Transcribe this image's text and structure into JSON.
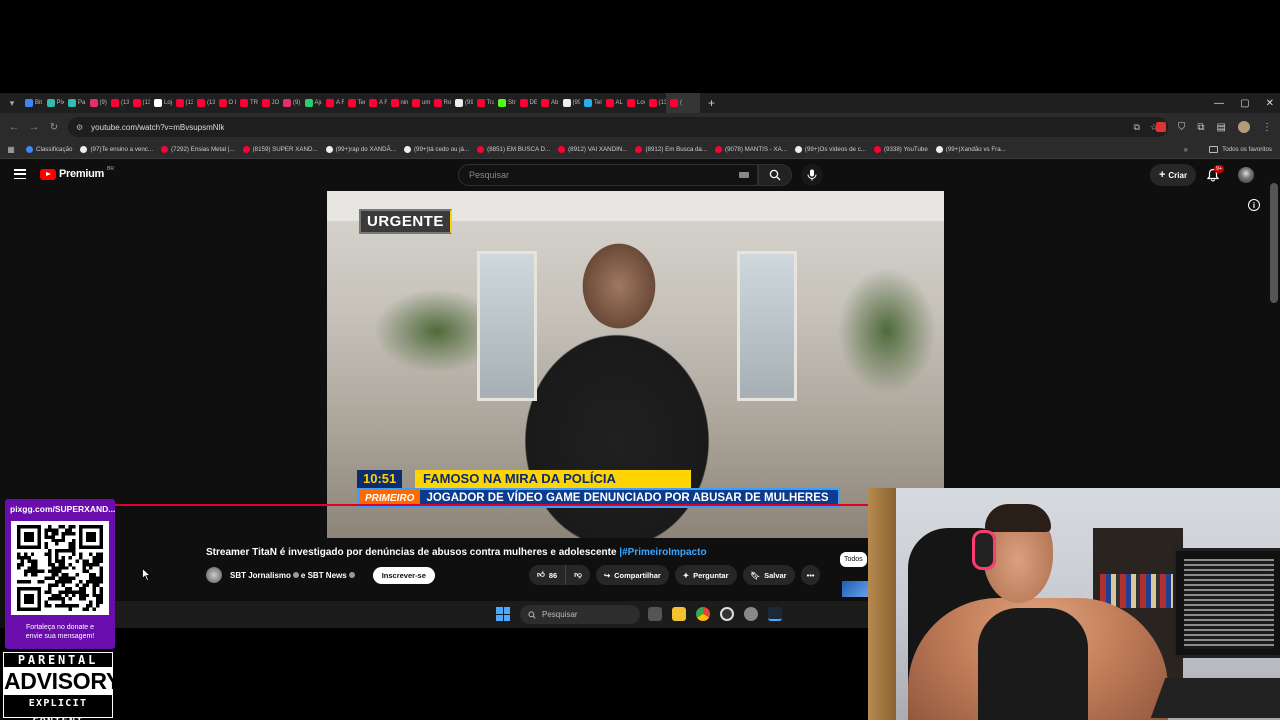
{
  "browser": {
    "tabs": [
      {
        "label": "Bit",
        "color": "#4285f4"
      },
      {
        "label": "Pix",
        "color": "#32bcad"
      },
      {
        "label": "Pa",
        "color": "#32bcad"
      },
      {
        "label": "(9)",
        "color": "#e1306c"
      },
      {
        "label": "(13",
        "color": "#ff0033"
      },
      {
        "label": "(13",
        "color": "#ff0033"
      },
      {
        "label": "Loj",
        "color": "#ffffff"
      },
      {
        "label": "(13",
        "color": "#ff0033"
      },
      {
        "label": "(13",
        "color": "#ff0033"
      },
      {
        "label": "O I",
        "color": "#ff0033"
      },
      {
        "label": "TR",
        "color": "#ff0033"
      },
      {
        "label": "JOI",
        "color": "#ff0033"
      },
      {
        "label": "(9)",
        "color": "#e1306c"
      },
      {
        "label": "Aju",
        "color": "#2ecc71"
      },
      {
        "label": "A F",
        "color": "#ff0033"
      },
      {
        "label": "Ten",
        "color": "#ff0033"
      },
      {
        "label": "A F",
        "color": "#ff0033"
      },
      {
        "label": "nin",
        "color": "#ff0033"
      },
      {
        "label": "um",
        "color": "#ff0033"
      },
      {
        "label": "Ro",
        "color": "#ff0033"
      },
      {
        "label": "(99",
        "color": "#eeeeee"
      },
      {
        "label": "Tra",
        "color": "#ff0033"
      },
      {
        "label": "Stre",
        "color": "#53fc18"
      },
      {
        "label": "DE",
        "color": "#ff0033"
      },
      {
        "label": "Ab",
        "color": "#ff0033"
      },
      {
        "label": "(99",
        "color": "#eeeeee"
      },
      {
        "label": "Tel",
        "color": "#2aabee"
      },
      {
        "label": "AL",
        "color": "#ff0033"
      },
      {
        "label": "Lov",
        "color": "#ff0033"
      },
      {
        "label": "(13",
        "color": "#ff0033"
      },
      {
        "label": "(",
        "color": "#ff0033"
      }
    ],
    "url": "youtube.com/watch?v=mBvsupsmNlk",
    "bookmarks": [
      {
        "label": "Classificação",
        "color": "#4285f4"
      },
      {
        "label": "(97)Te ensino a venc...",
        "color": "#eeeeee"
      },
      {
        "label": "(7292) Ensias Metal |...",
        "color": "#ff0033"
      },
      {
        "label": "(8159) SUPER XAND...",
        "color": "#ff0033"
      },
      {
        "label": "(99+)rap do XANDÃ...",
        "color": "#eeeeee"
      },
      {
        "label": "(99+)tá cedo ou já...",
        "color": "#eeeeee"
      },
      {
        "label": "(8851) EM BUSCA D...",
        "color": "#ff0033"
      },
      {
        "label": "(8912) VAI XANDIN...",
        "color": "#ff0033"
      },
      {
        "label": "(8912) Em Busca da...",
        "color": "#ff0033"
      },
      {
        "label": "(9078) MANTIS - XA...",
        "color": "#ff0033"
      },
      {
        "label": "(99+)Os vídeos de c...",
        "color": "#eeeeee"
      },
      {
        "label": "(9338) YouTube",
        "color": "#ff0033"
      },
      {
        "label": "(99+)Xandão vs Fra...",
        "color": "#eeeeee"
      }
    ],
    "bookmarks_more": "»",
    "all_favorites": "Todos os favoritos"
  },
  "youtube": {
    "brand": "Premium",
    "country": "BR",
    "search_placeholder": "Pesquisar",
    "create_label": "Criar",
    "notification_badge": "9+",
    "video": {
      "badge": "URGENTE",
      "ticker_time": "10:51",
      "ticker_headline": "FAMOSO NA MIRA DA POLÍCIA",
      "ticker_show": "PRIMEIRO",
      "ticker_subtext": "JOGADOR DE VÍDEO GAME DENUNCIADO POR ABUSAR DE MULHERES"
    },
    "title_main": "Streamer TitaN é investigado por denúncias de abusos contra mulheres e adolescente ",
    "title_tag": "|#PrimeiroImpacto",
    "channel": "SBT Jornalismo",
    "channel_joiner": "e SBT News",
    "subscribe_label": "Inscrever-se",
    "like_count": "86",
    "share_label": "Compartilhar",
    "ask_label": "Perguntar",
    "save_label": "Salvar",
    "chip_all": "Todos"
  },
  "taskbar": {
    "search_placeholder": "Pesquisar"
  },
  "overlay": {
    "qr_url": "pixgg.com/SUPERXAND...",
    "qr_caption_1": "Fortaleça no donate e",
    "qr_caption_2": "envie sua mensagem!",
    "advisory_top": "PARENTAL",
    "advisory_mid": "ADVISORY",
    "advisory_bot": "EXPLICIT CONTENT"
  }
}
